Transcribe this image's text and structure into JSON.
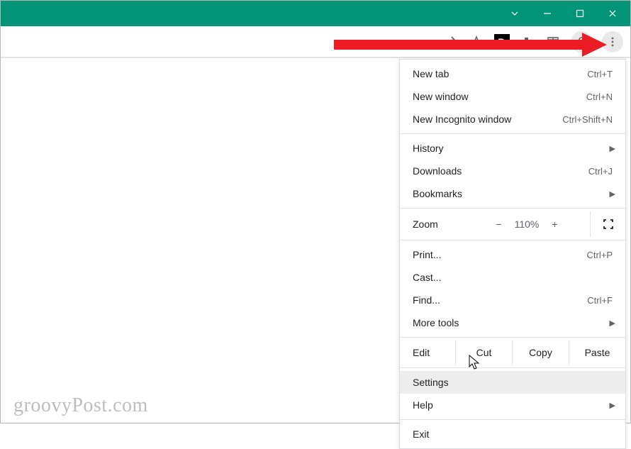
{
  "menu": {
    "new_tab": {
      "label": "New tab",
      "shortcut": "Ctrl+T"
    },
    "new_window": {
      "label": "New window",
      "shortcut": "Ctrl+N"
    },
    "new_incognito": {
      "label": "New Incognito window",
      "shortcut": "Ctrl+Shift+N"
    },
    "history": {
      "label": "History"
    },
    "downloads": {
      "label": "Downloads",
      "shortcut": "Ctrl+J"
    },
    "bookmarks": {
      "label": "Bookmarks"
    },
    "zoom": {
      "label": "Zoom",
      "value": "110%",
      "minus": "−",
      "plus": "+"
    },
    "print": {
      "label": "Print...",
      "shortcut": "Ctrl+P"
    },
    "cast": {
      "label": "Cast..."
    },
    "find": {
      "label": "Find...",
      "shortcut": "Ctrl+F"
    },
    "more_tools": {
      "label": "More tools"
    },
    "edit": {
      "label": "Edit",
      "cut": "Cut",
      "copy": "Copy",
      "paste": "Paste"
    },
    "settings": {
      "label": "Settings"
    },
    "help": {
      "label": "Help"
    },
    "exit": {
      "label": "Exit"
    }
  },
  "watermark": "groovyPost.com"
}
